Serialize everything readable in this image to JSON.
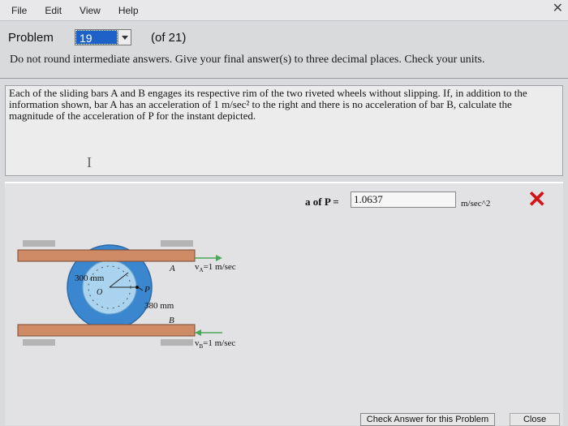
{
  "menu": {
    "file": "File",
    "edit": "Edit",
    "view": "View",
    "help": "Help"
  },
  "problem": {
    "label": "Problem",
    "selected": "19",
    "of_total": "(of 21)"
  },
  "instructions": "Do not round intermediate answers.  Give your final answer(s) to three decimal places.  Check your units.",
  "statement": "Each of the sliding bars A and B engages its respective rim of the two riveted wheels without slipping. If, in addition to the information shown, bar A has an acceleration of 1 m/sec² to the right and there is no acceleration of bar B, calculate the magnitude of the acceleration of P for the instant depicted.",
  "caret": "I",
  "answer": {
    "label": "a of P =",
    "value": "1.0637",
    "unit": "m/sec^2",
    "status": "✕"
  },
  "diagram": {
    "label_A": "A",
    "label_B": "B",
    "label_O": "O",
    "label_P": "P",
    "inner_radius": "300 mm",
    "outer_radius": "380 mm",
    "vA": "v",
    "vA_sub": "A",
    "vA_val": "=1 m/sec",
    "vB": "v",
    "vB_sub": "B",
    "vB_val": "=1 m/sec"
  },
  "buttons": {
    "check": "Check Answer for this Problem",
    "close": "Close"
  },
  "colors": {
    "bar": "#cf8b66",
    "outer_wheel": "#3b87cf",
    "inner_wheel": "#aad3ef",
    "arrow": "#4aa85a",
    "wrong": "#d11414"
  }
}
